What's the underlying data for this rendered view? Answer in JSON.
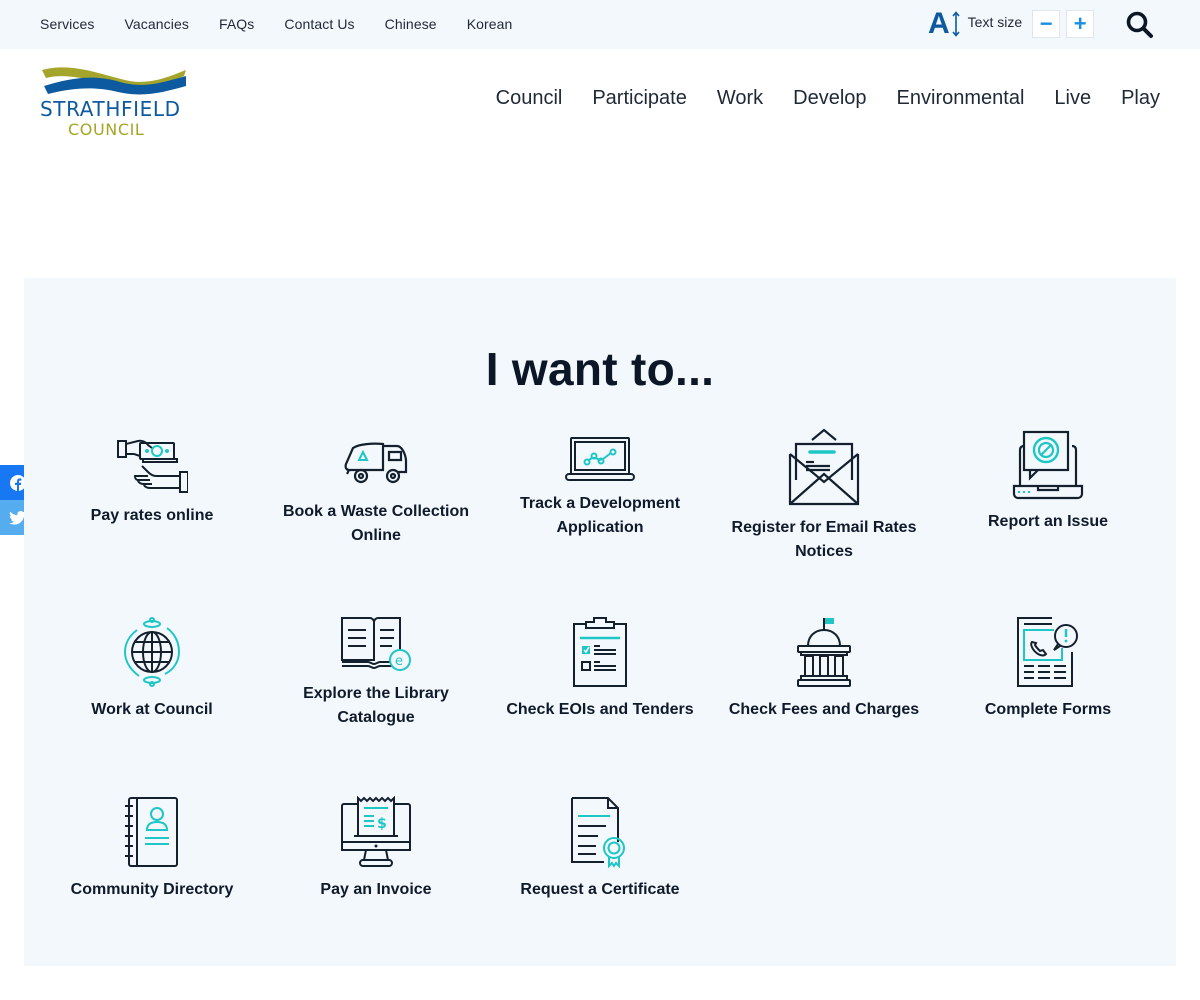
{
  "utility_bar": {
    "links": [
      "Services",
      "Vacancies",
      "FAQs",
      "Contact Us",
      "Chinese",
      "Korean"
    ],
    "text_size": {
      "icon": "text-size-icon",
      "label": "Text size",
      "decrease": "−",
      "increase": "+"
    },
    "search_icon": "search-icon"
  },
  "header": {
    "logo": {
      "line1": "STRATHFIELD",
      "line2": "COUNCIL"
    },
    "nav": [
      "Council",
      "Participate",
      "Work",
      "Develop",
      "Environmental",
      "Live",
      "Play"
    ]
  },
  "share": {
    "items": [
      "facebook-icon",
      "twitter-icon"
    ]
  },
  "panel": {
    "heading": "I want to...",
    "tiles": [
      {
        "label": "Pay rates online",
        "icon": "hand-money-icon"
      },
      {
        "label": "Book a Waste Collection Online",
        "icon": "garbage-truck-icon"
      },
      {
        "label": "Track a Development Application",
        "icon": "laptop-chart-icon"
      },
      {
        "label": "Register for Email Rates Notices",
        "icon": "envelope-icon"
      },
      {
        "label": "Report an Issue",
        "icon": "laptop-alert-icon"
      },
      {
        "label": "Work at Council",
        "icon": "globe-icon"
      },
      {
        "label": "Explore the Library Catalogue",
        "icon": "ebook-icon"
      },
      {
        "label": "Check EOIs and Tenders",
        "icon": "clipboard-checklist-icon"
      },
      {
        "label": "Check Fees and Charges",
        "icon": "government-building-icon"
      },
      {
        "label": "Complete Forms",
        "icon": "form-phone-icon"
      },
      {
        "label": "Community Directory",
        "icon": "address-book-icon"
      },
      {
        "label": "Pay an Invoice",
        "icon": "monitor-invoice-icon"
      },
      {
        "label": "Request a Certificate",
        "icon": "certificate-icon"
      }
    ]
  },
  "colors": {
    "accent_teal": "#1fc6c6",
    "brand_blue": "#0d5aa0",
    "brand_olive": "#a4a52a",
    "panel_bg": "#f3f8fd",
    "icon_dark": "#14202e"
  }
}
